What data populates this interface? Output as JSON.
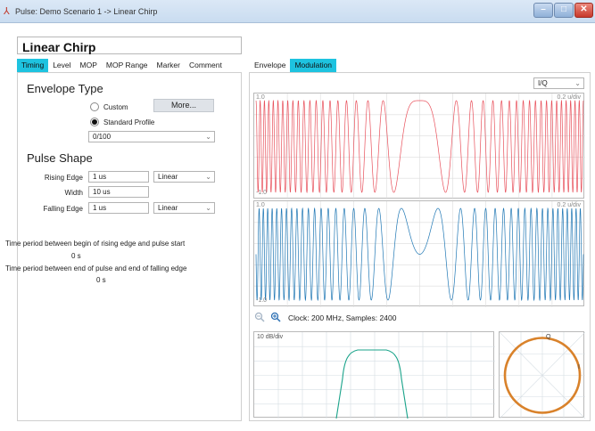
{
  "window": {
    "title": "Pulse: Demo Scenario 1 -> Linear Chirp"
  },
  "pulse_name": "Linear Chirp",
  "left_tabs": [
    "Timing",
    "Level",
    "MOP",
    "MOP Range",
    "Marker",
    "Comment"
  ],
  "left_active_tab": "Timing",
  "right_tabs": [
    "Envelope",
    "Modulation"
  ],
  "right_active_tab": "Modulation",
  "envelope_type": {
    "title": "Envelope Type",
    "custom_label": "Custom",
    "more_button": "More...",
    "standard_label": "Standard Profile",
    "selected": "Standard Profile",
    "profile_value": "0/100"
  },
  "pulse_shape": {
    "title": "Pulse Shape",
    "rising_edge_label": "Rising Edge",
    "rising_edge_value": "1 us",
    "rising_edge_shape": "Linear",
    "width_label": "Width",
    "width_value": "10 us",
    "falling_edge_label": "Falling Edge",
    "falling_edge_value": "1 us",
    "falling_edge_shape": "Linear"
  },
  "timing_info": {
    "rise_start_text": "Time period between begin of rising edge and pulse start",
    "rise_start_value": "0  s",
    "fall_end_text": "Time period between end of pulse and end of falling edge",
    "fall_end_value": "0  s"
  },
  "modulation": {
    "view_mode": "I/Q",
    "i_scale_top": "1.0",
    "i_scale_bottom": "-1.0",
    "i_div": "0.2 u/div",
    "q_scale_top": "1.0",
    "q_scale_bottom": "-1.0",
    "q_div": "0.2 u/div",
    "clock_text": "Clock: 200 MHz, Samples: 2400",
    "spectrum_div": "10 dB/div",
    "polar_label_q": "Q",
    "polar_label_i": "I"
  },
  "colors": {
    "accent_tab": "#1ec3e0",
    "i_trace": "#e8505b",
    "q_trace": "#1f77b4",
    "spectrum_trace": "#1aa38a",
    "polar_trace": "#d9822b"
  },
  "icons": [
    "app-icon",
    "minimize-icon",
    "maximize-icon",
    "close-icon",
    "zoom-out-icon",
    "zoom-in-icon",
    "chevron-down-icon"
  ]
}
